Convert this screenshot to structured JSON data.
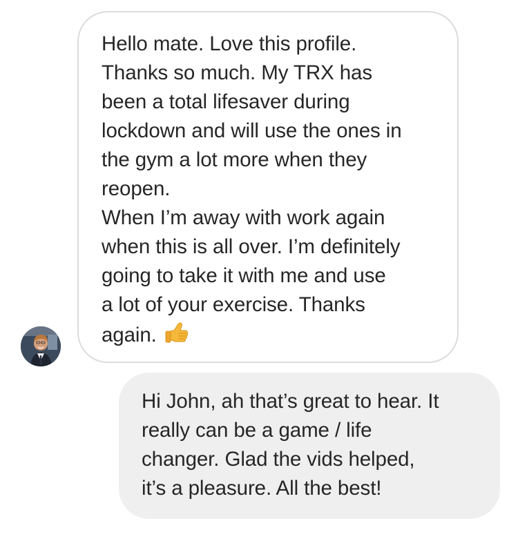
{
  "conversation": {
    "incoming": {
      "lines": [
        "Hello mate. Love this profile.",
        "Thanks so much. My TRX has",
        "been a total lifesaver during",
        "lockdown and will use the ones in",
        "the gym a lot more when they",
        "reopen.",
        "When I’m away with work again",
        "when this is all over. I’m definitely",
        "going to take it with me and use",
        "a lot of your exercise. Thanks",
        "again."
      ],
      "emoji": "thumbs-up-icon",
      "avatar": "sender-avatar"
    },
    "outgoing": {
      "lines": [
        "Hi John, ah that’s great to hear. It",
        "really can be a game / life",
        "changer. Glad the vids helped,",
        "it’s a pleasure. All the best!"
      ]
    }
  },
  "colors": {
    "incoming_border": "#dbdbdb",
    "outgoing_background": "#efefef",
    "text": "#262626",
    "emoji": "#f6b83b"
  }
}
